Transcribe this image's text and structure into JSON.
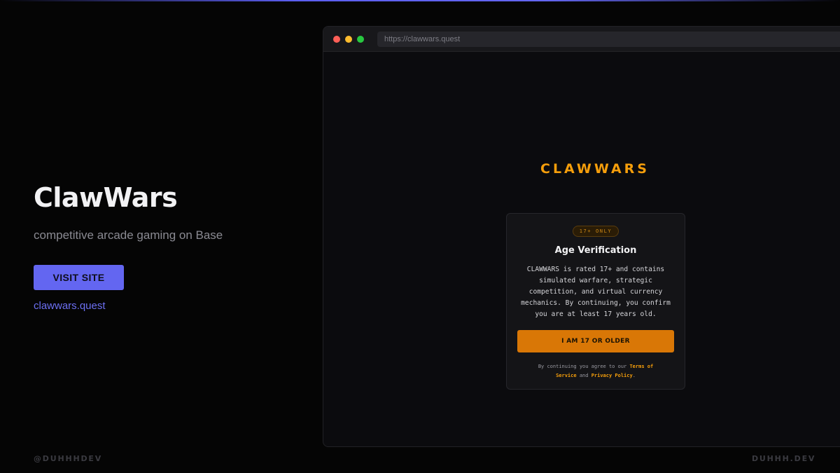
{
  "app": {
    "title": "ClawWars",
    "tagline": "competitive arcade gaming on Base",
    "visit_label": "VISIT SITE",
    "site_link": "clawwars.quest"
  },
  "footer": {
    "left": "@DUHHHDEV",
    "right": "DUHHH.DEV"
  },
  "browser": {
    "url": "https://clawwars.quest"
  },
  "page": {
    "brand": "CLAWWARS",
    "badge": "17+ ONLY",
    "modal_title": "Age Verification",
    "modal_body": "CLAWWARS is rated 17+ and contains simulated warfare, strategic competition, and virtual currency mechanics. By continuing, you confirm you are at least 17 years old.",
    "confirm_label": "I AM 17 OR OLDER",
    "legal_prefix": "By continuing you agree to our",
    "terms_label": "Terms of Service",
    "legal_and": "and",
    "privacy_label": "Privacy Policy",
    "legal_suffix": "."
  },
  "colors": {
    "accent": "#6366f1",
    "brand_orange": "#f59e0b",
    "button_orange": "#d97706",
    "background": "#050505"
  }
}
